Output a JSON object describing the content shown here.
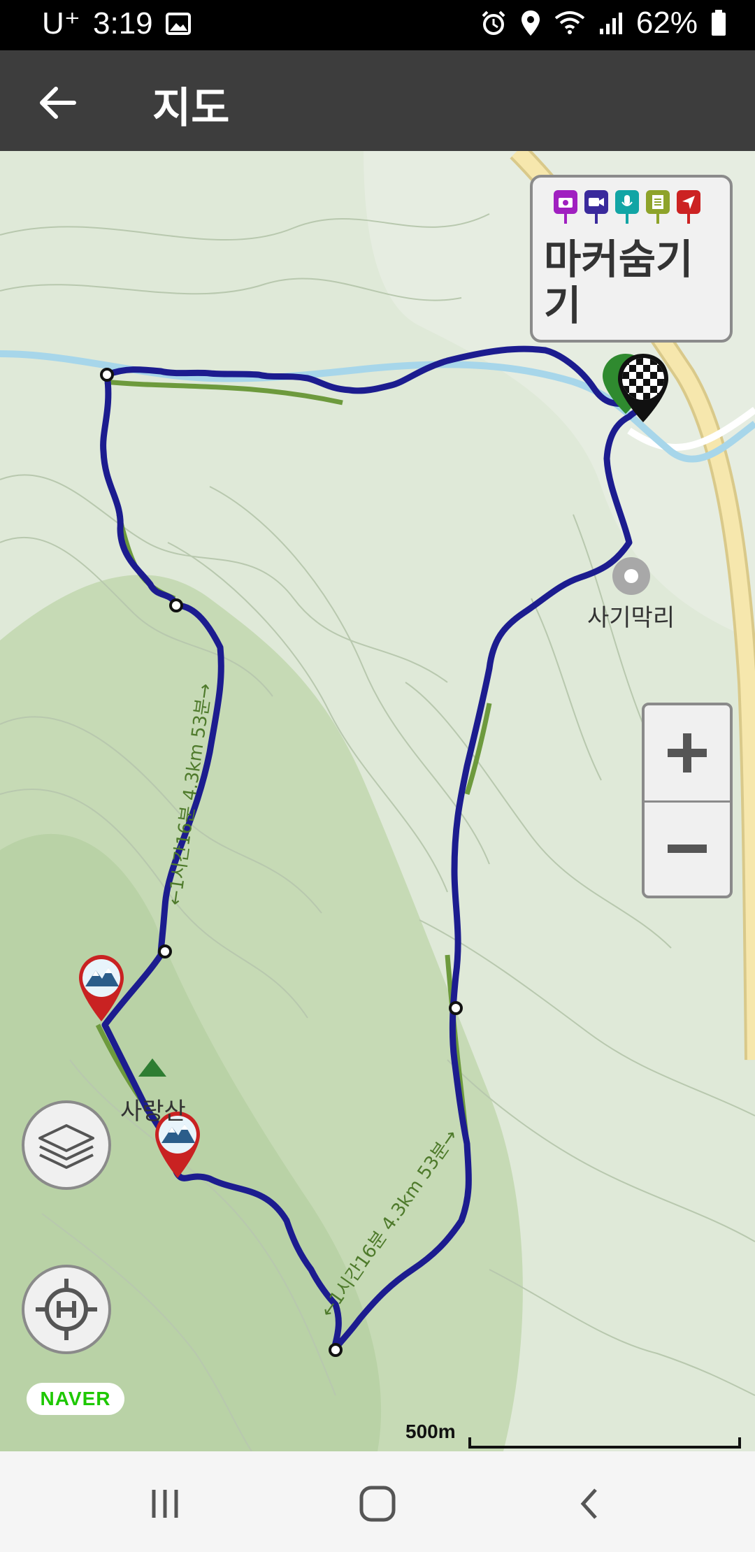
{
  "status_bar": {
    "carrier": "U⁺",
    "time": "3:19",
    "battery": "62%",
    "icons": [
      "image-icon",
      "alarm-icon",
      "location-icon",
      "wifi-icon",
      "signal-icon",
      "battery-icon"
    ]
  },
  "app_bar": {
    "title": "지도",
    "back_icon": "arrow-left-icon"
  },
  "map": {
    "marker_legend": {
      "pin_colors": [
        "#a020c0",
        "#3a2a9c",
        "#12a5a5",
        "#8ea32a",
        "#cc2222"
      ],
      "pin_icons": [
        "camera-icon",
        "video-icon",
        "microphone-icon",
        "note-icon",
        "navigation-icon"
      ],
      "label": "마커숨기기"
    },
    "place_labels": {
      "village": "사기막리",
      "mountain": "사랑산"
    },
    "route_labels": {
      "upper": "←1시간16분 4.3km 53분→",
      "lower": "←1시간16분 4.3km 53분→"
    },
    "zoom": {
      "plus_icon": "plus-icon",
      "minus_icon": "minus-icon"
    },
    "layers_icon": "layers-icon",
    "locate_icon": "crosshair-h-icon",
    "provider": "NAVER",
    "scale": "500m",
    "colors": {
      "route": "#1c1c8f",
      "trail": "#6d9a3d",
      "road": "#f3e3a7",
      "river": "#9fd3ea"
    }
  },
  "nav_bar": {
    "recent_icon": "recent-apps-icon",
    "home_icon": "home-icon",
    "back_icon": "back-chevron-icon"
  }
}
